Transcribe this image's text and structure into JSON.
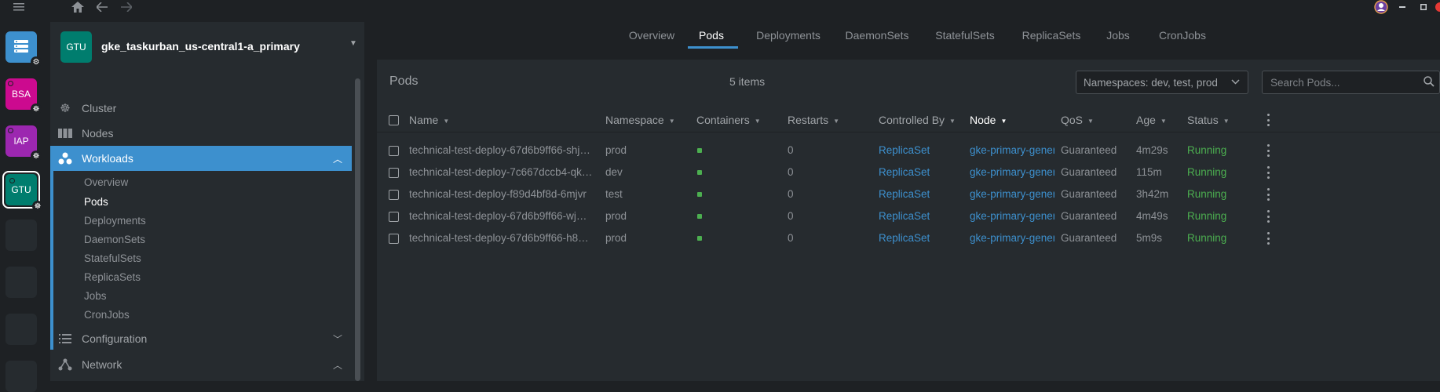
{
  "topbar": {
    "menu_icon": "hamburger-icon",
    "home_icon": "home-icon",
    "back_icon": "arrow-left-icon",
    "forward_icon": "arrow-right-icon"
  },
  "hotbar": {
    "items": [
      {
        "label": "",
        "icon": "catalog-icon",
        "color": "#3d90ce"
      },
      {
        "label": "BSA",
        "color": "#cc0a8f"
      },
      {
        "label": "IAP",
        "color": "#9c27b0"
      },
      {
        "label": "GTU",
        "color": "#007d6e"
      }
    ]
  },
  "sidebar": {
    "cluster": {
      "avatar": "GTU",
      "name": "gke_taskurban_us-central1-a_primary"
    },
    "items": [
      {
        "label": "Cluster",
        "icon": "helm-wheel-icon"
      },
      {
        "label": "Nodes",
        "icon": "nodes-icon"
      },
      {
        "label": "Workloads",
        "icon": "workloads-icon"
      },
      {
        "label": "Configuration",
        "icon": "list-icon"
      },
      {
        "label": "Network",
        "icon": "network-icon"
      }
    ],
    "workloads_sub": [
      "Overview",
      "Pods",
      "Deployments",
      "DaemonSets",
      "StatefulSets",
      "ReplicaSets",
      "Jobs",
      "CronJobs"
    ]
  },
  "tabs": [
    "Overview",
    "Pods",
    "Deployments",
    "DaemonSets",
    "StatefulSets",
    "ReplicaSets",
    "Jobs",
    "CronJobs"
  ],
  "panel": {
    "title": "Pods",
    "count": "5 items",
    "namespace_filter": "Namespaces: dev, test, prod",
    "search_placeholder": "Search Pods..."
  },
  "table": {
    "columns": [
      "Name",
      "Namespace",
      "Containers",
      "Restarts",
      "Controlled By",
      "Node",
      "QoS",
      "Age",
      "Status"
    ],
    "rows": [
      {
        "name": "technical-test-deploy-67d6b9ff66-shj…",
        "namespace": "prod",
        "restarts": "0",
        "controlled_by": "ReplicaSet",
        "node": "gke-primary-genera",
        "qos": "Guaranteed",
        "age": "4m29s",
        "status": "Running"
      },
      {
        "name": "technical-test-deploy-7c667dccb4-qk…",
        "namespace": "dev",
        "restarts": "0",
        "controlled_by": "ReplicaSet",
        "node": "gke-primary-genera",
        "qos": "Guaranteed",
        "age": "115m",
        "status": "Running"
      },
      {
        "name": "technical-test-deploy-f89d4bf8d-6mjvr",
        "namespace": "test",
        "restarts": "0",
        "controlled_by": "ReplicaSet",
        "node": "gke-primary-genera",
        "qos": "Guaranteed",
        "age": "3h42m",
        "status": "Running"
      },
      {
        "name": "technical-test-deploy-67d6b9ff66-wj…",
        "namespace": "prod",
        "restarts": "0",
        "controlled_by": "ReplicaSet",
        "node": "gke-primary-genera",
        "qos": "Guaranteed",
        "age": "4m49s",
        "status": "Running"
      },
      {
        "name": "technical-test-deploy-67d6b9ff66-h8…",
        "namespace": "prod",
        "restarts": "0",
        "controlled_by": "ReplicaSet",
        "node": "gke-primary-genera",
        "qos": "Guaranteed",
        "age": "5m9s",
        "status": "Running"
      }
    ]
  }
}
